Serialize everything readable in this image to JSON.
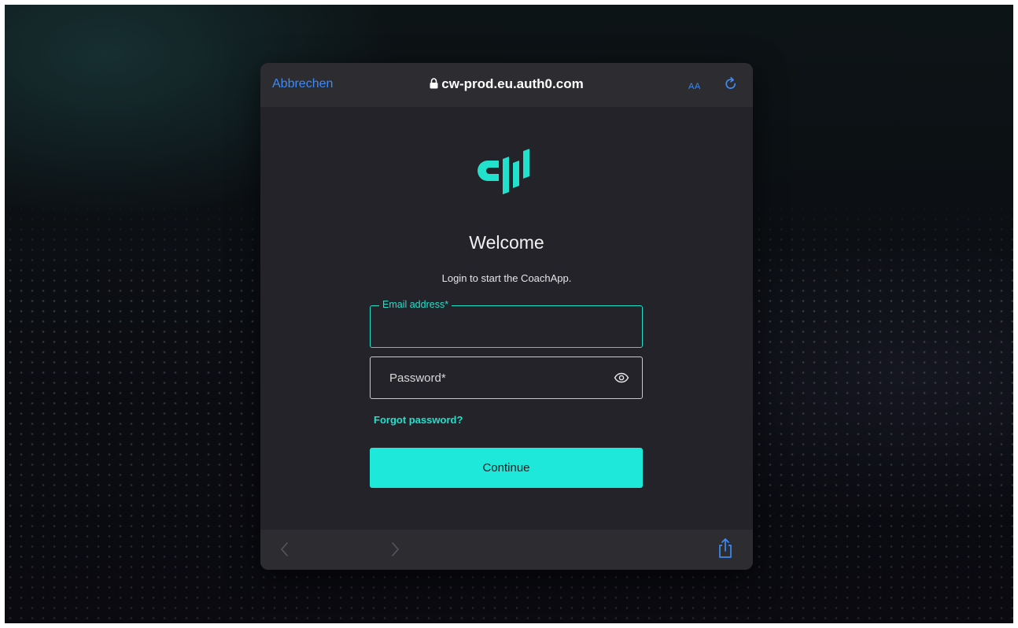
{
  "browser": {
    "cancel_label": "Abbrechen",
    "url": "cw-prod.eu.auth0.com",
    "text_size_label": "AA",
    "accent_color": "#3d8bf7"
  },
  "brand": {
    "logo_text": "CW",
    "accent_color": "#21e0cc"
  },
  "login": {
    "title": "Welcome",
    "subtitle": "Login to start the CoachApp.",
    "email": {
      "label": "Email address*",
      "value": ""
    },
    "password": {
      "placeholder": "Password*",
      "value": ""
    },
    "forgot_password": "Forgot password?",
    "continue_label": "Continue"
  },
  "icons": {
    "lock": "lock-icon",
    "reload": "reload-icon",
    "eye": "eye-icon",
    "back": "chevron-left-icon",
    "forward": "chevron-right-icon",
    "share": "share-icon"
  }
}
